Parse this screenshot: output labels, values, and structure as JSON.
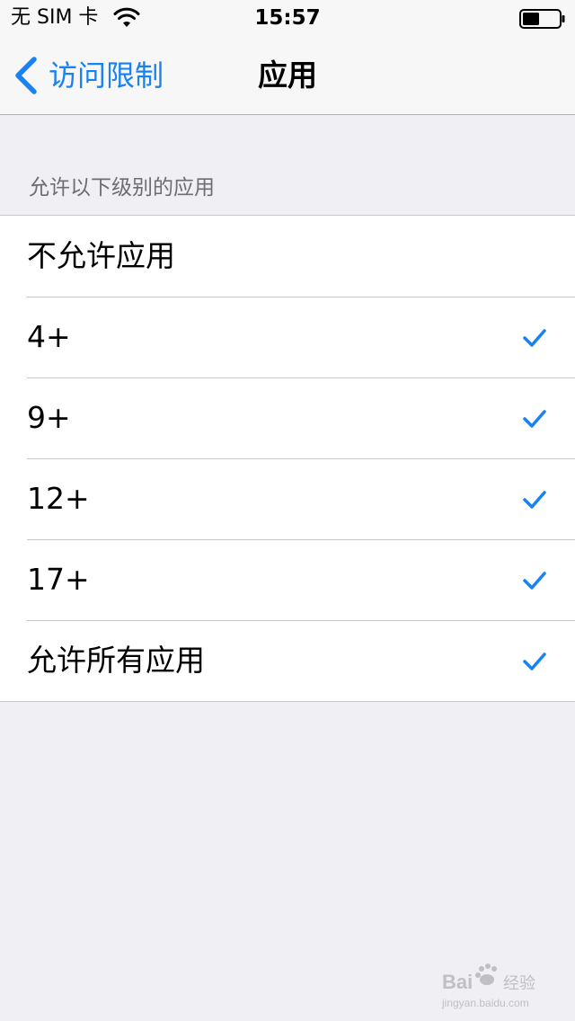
{
  "status_bar": {
    "carrier": "无 SIM 卡",
    "time": "15:57",
    "wifi_icon": "wifi-icon",
    "battery_icon": "battery-icon",
    "battery_level": 0.45
  },
  "nav": {
    "back_label": "访问限制",
    "title": "应用",
    "back_icon": "chevron-left-icon"
  },
  "section": {
    "header": "允许以下级别的应用"
  },
  "options": [
    {
      "label": "不允许应用",
      "checked": false
    },
    {
      "label": "4+",
      "checked": true
    },
    {
      "label": "9+",
      "checked": true
    },
    {
      "label": "12+",
      "checked": true
    },
    {
      "label": "17+",
      "checked": true
    },
    {
      "label": "允许所有应用",
      "checked": true
    }
  ],
  "watermark": {
    "brand": "Bai 经验",
    "url": "jingyan.baidu.com"
  },
  "colors": {
    "accent": "#1a82f0",
    "background": "#efeff4",
    "bar": "#f7f7f7",
    "separator": "#c8c7cc",
    "section_text": "#6d6d72"
  }
}
